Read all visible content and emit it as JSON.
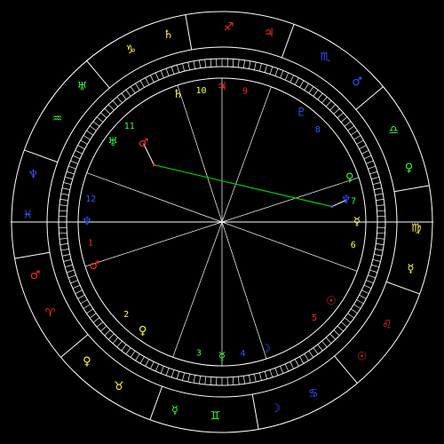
{
  "colors": {
    "background": "#000000",
    "lines": "#ffffff",
    "fire": "#ff2a2a",
    "earth": "#ffff33",
    "air": "#33ff33",
    "water": "#3355ff",
    "aspect_green": "#00cc00"
  },
  "signs": [
    {
      "name": "aries-sign",
      "glyph": "♈",
      "color": "#ff2a2a"
    },
    {
      "name": "taurus-sign",
      "glyph": "♉",
      "color": "#ffff33"
    },
    {
      "name": "gemini-sign",
      "glyph": "♊",
      "color": "#33ff33"
    },
    {
      "name": "cancer-sign",
      "glyph": "♋",
      "color": "#3355ff"
    },
    {
      "name": "leo-sign",
      "glyph": "♌",
      "color": "#ff2a2a"
    },
    {
      "name": "virgo-sign",
      "glyph": "♍",
      "color": "#ffff33"
    },
    {
      "name": "libra-sign",
      "glyph": "♎",
      "color": "#33ff33"
    },
    {
      "name": "scorpio-sign",
      "glyph": "♏",
      "color": "#3355ff"
    },
    {
      "name": "sagittarius-sign",
      "glyph": "♐",
      "color": "#ff2a2a"
    },
    {
      "name": "capricorn-sign",
      "glyph": "♑",
      "color": "#ffff33"
    },
    {
      "name": "aquarius-sign",
      "glyph": "♒",
      "color": "#33ff33"
    },
    {
      "name": "pisces-sign",
      "glyph": "♓",
      "color": "#3355ff"
    }
  ],
  "rulers": [
    {
      "name": "aries-ruler",
      "glyph": "♂",
      "color": "#ff2a2a"
    },
    {
      "name": "taurus-ruler",
      "glyph": "♀",
      "color": "#ffff33"
    },
    {
      "name": "gemini-ruler",
      "glyph": "☿",
      "color": "#33ff33"
    },
    {
      "name": "cancer-ruler",
      "glyph": "☽",
      "color": "#3355ff"
    },
    {
      "name": "leo-ruler",
      "glyph": "☉",
      "color": "#ff2a2a"
    },
    {
      "name": "virgo-ruler",
      "glyph": "☿",
      "color": "#ffff33"
    },
    {
      "name": "libra-ruler",
      "glyph": "♀",
      "color": "#33ff33"
    },
    {
      "name": "scorpio-ruler",
      "glyph": "♂",
      "color": "#3355ff"
    },
    {
      "name": "sagittarius-ruler",
      "glyph": "♃",
      "color": "#ff2a2a"
    },
    {
      "name": "capricorn-ruler",
      "glyph": "♄",
      "color": "#ffff33"
    },
    {
      "name": "aquarius-ruler",
      "glyph": "♅",
      "color": "#33ff33"
    },
    {
      "name": "pisces-ruler",
      "glyph": "♆",
      "color": "#3355ff"
    }
  ],
  "houses": [
    {
      "number": "1",
      "color": "#ff2a2a",
      "ruler": "♂"
    },
    {
      "number": "2",
      "color": "#ffff33",
      "ruler": "♀"
    },
    {
      "number": "3",
      "color": "#33ff33",
      "ruler": "☿"
    },
    {
      "number": "4",
      "color": "#3355ff",
      "ruler": "☽"
    },
    {
      "number": "5",
      "color": "#ff2a2a",
      "ruler": "☉"
    },
    {
      "number": "6",
      "color": "#ffff33",
      "ruler": "☿"
    },
    {
      "number": "7",
      "color": "#33ff33",
      "ruler": "♀"
    },
    {
      "number": "8",
      "color": "#3355ff",
      "ruler": "♇"
    },
    {
      "number": "9",
      "color": "#ff2a2a",
      "ruler": "♃"
    },
    {
      "number": "10",
      "color": "#ffff33",
      "ruler": "♄"
    },
    {
      "number": "11",
      "color": "#33ff33",
      "ruler": "♅"
    },
    {
      "number": "12",
      "color": "#3355ff",
      "ruler": "♆"
    }
  ],
  "planets": [
    {
      "name": "mars-planet",
      "glyph": "♂",
      "color": "#ff2a2a"
    },
    {
      "name": "neptune-planet",
      "glyph": "♆",
      "color": "#3355ff"
    }
  ]
}
